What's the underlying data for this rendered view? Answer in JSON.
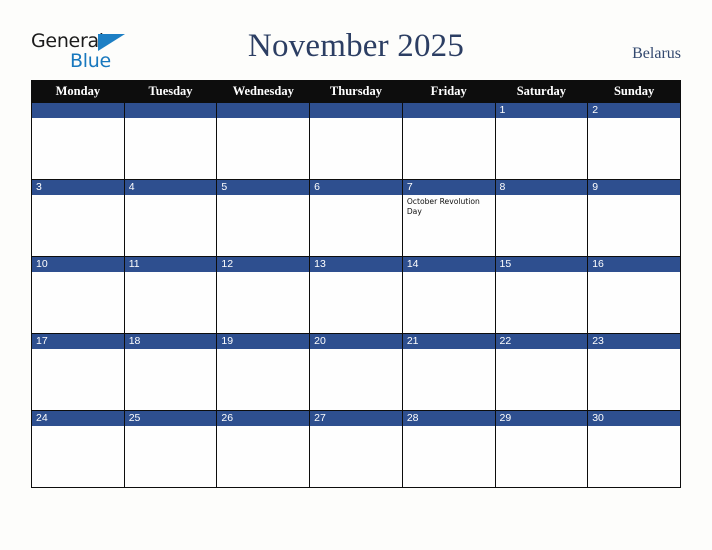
{
  "brand": {
    "name_line1": "General",
    "name_line2": "Blue",
    "triangle_color": "#1d7fc4",
    "line1_color": "#1b1b1b",
    "line2_color": "#1878be"
  },
  "header": {
    "title": "November 2025",
    "country": "Belarus",
    "title_color": "#2c3e63",
    "country_color": "#33496f"
  },
  "calendar": {
    "weekday_headers": [
      "Monday",
      "Tuesday",
      "Wednesday",
      "Thursday",
      "Friday",
      "Saturday",
      "Sunday"
    ],
    "header_bg": "#0d0d0d",
    "header_text_color": "#ffffff",
    "daynum_band_color": "#2e4f8f",
    "daynum_text_color": "#ffffff",
    "cell_bg": "#fefefe",
    "border_color": "#0d0d0d",
    "weeks": [
      [
        {
          "day": "",
          "events": ""
        },
        {
          "day": "",
          "events": ""
        },
        {
          "day": "",
          "events": ""
        },
        {
          "day": "",
          "events": ""
        },
        {
          "day": "",
          "events": ""
        },
        {
          "day": "1",
          "events": ""
        },
        {
          "day": "2",
          "events": ""
        }
      ],
      [
        {
          "day": "3",
          "events": ""
        },
        {
          "day": "4",
          "events": ""
        },
        {
          "day": "5",
          "events": ""
        },
        {
          "day": "6",
          "events": ""
        },
        {
          "day": "7",
          "events": "October Revolution Day"
        },
        {
          "day": "8",
          "events": ""
        },
        {
          "day": "9",
          "events": ""
        }
      ],
      [
        {
          "day": "10",
          "events": ""
        },
        {
          "day": "11",
          "events": ""
        },
        {
          "day": "12",
          "events": ""
        },
        {
          "day": "13",
          "events": ""
        },
        {
          "day": "14",
          "events": ""
        },
        {
          "day": "15",
          "events": ""
        },
        {
          "day": "16",
          "events": ""
        }
      ],
      [
        {
          "day": "17",
          "events": ""
        },
        {
          "day": "18",
          "events": ""
        },
        {
          "day": "19",
          "events": ""
        },
        {
          "day": "20",
          "events": ""
        },
        {
          "day": "21",
          "events": ""
        },
        {
          "day": "22",
          "events": ""
        },
        {
          "day": "23",
          "events": ""
        }
      ],
      [
        {
          "day": "24",
          "events": ""
        },
        {
          "day": "25",
          "events": ""
        },
        {
          "day": "26",
          "events": ""
        },
        {
          "day": "27",
          "events": ""
        },
        {
          "day": "28",
          "events": ""
        },
        {
          "day": "29",
          "events": ""
        },
        {
          "day": "30",
          "events": ""
        }
      ]
    ]
  }
}
